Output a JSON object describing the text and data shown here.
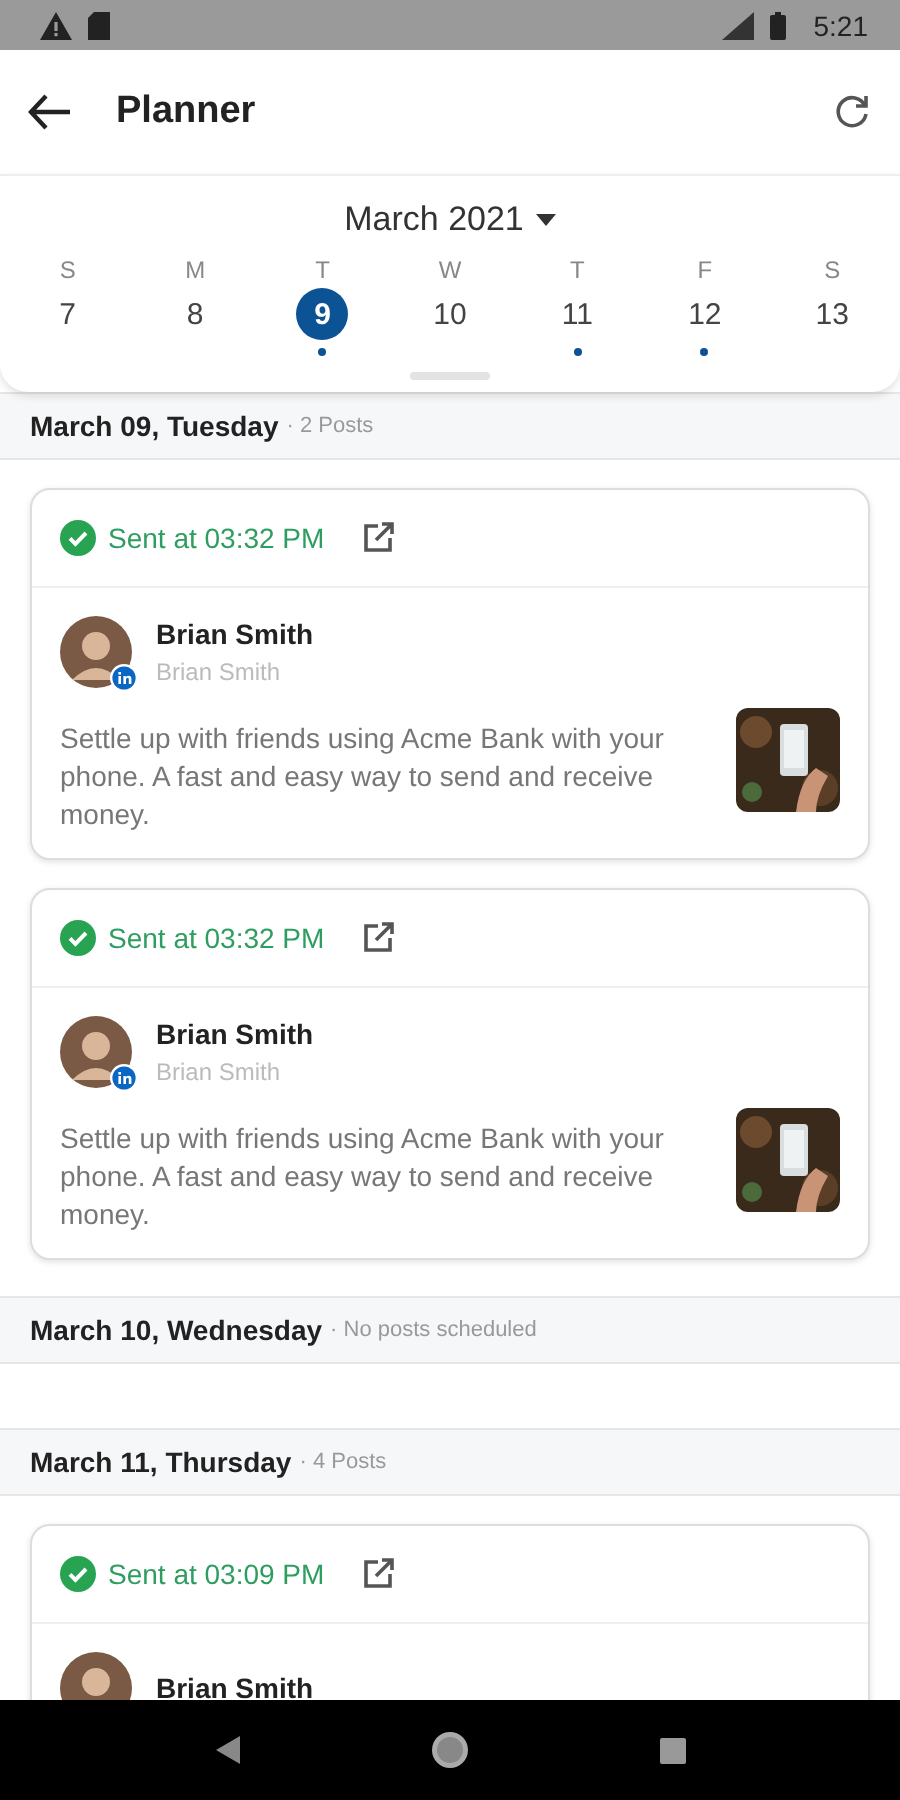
{
  "status_bar": {
    "time": "5:21"
  },
  "app_bar": {
    "title": "Planner"
  },
  "calendar": {
    "month": "March 2021",
    "days": [
      {
        "weekday": "S",
        "date": "7",
        "selected": false,
        "has_posts": false
      },
      {
        "weekday": "M",
        "date": "8",
        "selected": false,
        "has_posts": false
      },
      {
        "weekday": "T",
        "date": "9",
        "selected": true,
        "has_posts": true
      },
      {
        "weekday": "W",
        "date": "10",
        "selected": false,
        "has_posts": false
      },
      {
        "weekday": "T",
        "date": "11",
        "selected": false,
        "has_posts": true
      },
      {
        "weekday": "F",
        "date": "12",
        "selected": false,
        "has_posts": true
      },
      {
        "weekday": "S",
        "date": "13",
        "selected": false,
        "has_posts": false
      }
    ]
  },
  "sections": [
    {
      "date": "March 09, Tuesday",
      "summary": "· 2 Posts",
      "posts": [
        {
          "status": "Sent at 03:32 PM",
          "author": "Brian Smith",
          "account": "Brian Smith",
          "text": "Settle up with friends using Acme Bank with your phone.  A fast and easy way to send and receive money."
        },
        {
          "status": "Sent at 03:32 PM",
          "author": "Brian Smith",
          "account": "Brian Smith",
          "text": "Settle up with friends using Acme Bank with your phone.  A fast and easy way to send and receive money."
        }
      ]
    },
    {
      "date": "March 10, Wednesday",
      "summary": "· No posts scheduled"
    },
    {
      "date": "March 11, Thursday",
      "summary": "· 4 Posts",
      "posts": [
        {
          "status": "Sent at 03:09 PM",
          "author": "Brian Smith"
        }
      ]
    }
  ]
}
